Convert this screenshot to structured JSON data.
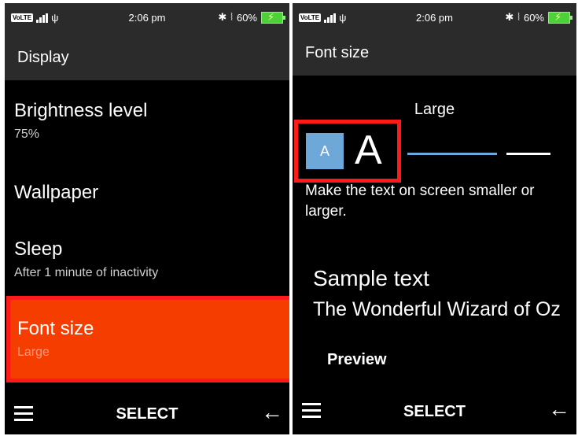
{
  "status": {
    "network": "VoLTE",
    "signal": "4G",
    "time": "2:06 pm",
    "bluetooth": "✱",
    "vibrate": "⦚",
    "battery": "60%"
  },
  "display_screen": {
    "title": "Display",
    "items": [
      {
        "title": "Brightness level",
        "subtitle": "75%"
      },
      {
        "title": "Wallpaper",
        "subtitle": ""
      },
      {
        "title": "Sleep",
        "subtitle": "After 1 minute of inactivity"
      },
      {
        "title": "Font size",
        "subtitle": "Large"
      }
    ],
    "softkeys": {
      "center": "SELECT",
      "right": "←"
    }
  },
  "font_screen": {
    "title": "Font size",
    "selected_size": "Large",
    "small_glyph": "A",
    "large_glyph": "A",
    "description": "Make the text on screen smaller or larger.",
    "sample_label": "Sample text",
    "sample_text": "The Wonderful Wizard of Oz",
    "preview_label": "Preview",
    "softkeys": {
      "center": "SELECT",
      "right": "←"
    }
  },
  "colors": {
    "highlight": "#f53d00",
    "annotation_border": "#ff1a1a",
    "slider_accent": "#6ea8d8"
  }
}
